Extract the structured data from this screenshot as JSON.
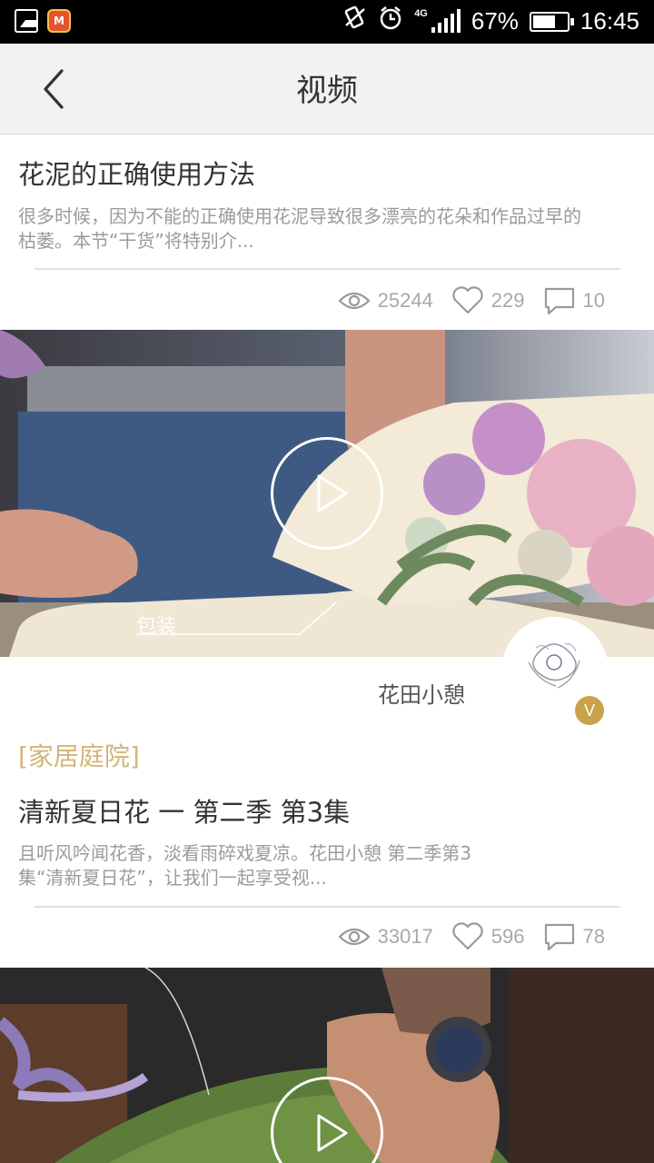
{
  "status_bar": {
    "battery": "67%",
    "time": "16:45",
    "network": "4G",
    "icons": [
      "gallery-icon",
      "app-icon",
      "vibrate-icon",
      "alarm-icon",
      "signal-icon",
      "battery-icon"
    ],
    "battery_level": 0.67
  },
  "nav": {
    "title": "视频",
    "back_icon": "back-arrow-icon"
  },
  "articles": [
    {
      "title": "花泥的正确使用方法",
      "description": "很多时候，因为不能的正确使用花泥导致很多漂亮的花朵和作品过早的枯萎。本节“干货”将特别介...",
      "views": "25244",
      "likes": "229",
      "comments": "10"
    },
    {
      "caption": "包装",
      "author": "花田小憩",
      "avatar_badge": "V",
      "category": "[家居庭院]",
      "title": "清新夏日花 一 第二季 第3集",
      "description": "且听风吟闻花香，淡看雨碎戏夏凉。花田小憩 第二季第3集“清新夏日花”，让我们一起享受视...",
      "views": "33017",
      "likes": "596",
      "comments": "78"
    }
  ],
  "colors": {
    "accent_gold": "#d4b47a",
    "badge_gold": "#c9a24a",
    "muted_text": "#9b9b9b",
    "nav_bg": "#f2f2f2"
  }
}
